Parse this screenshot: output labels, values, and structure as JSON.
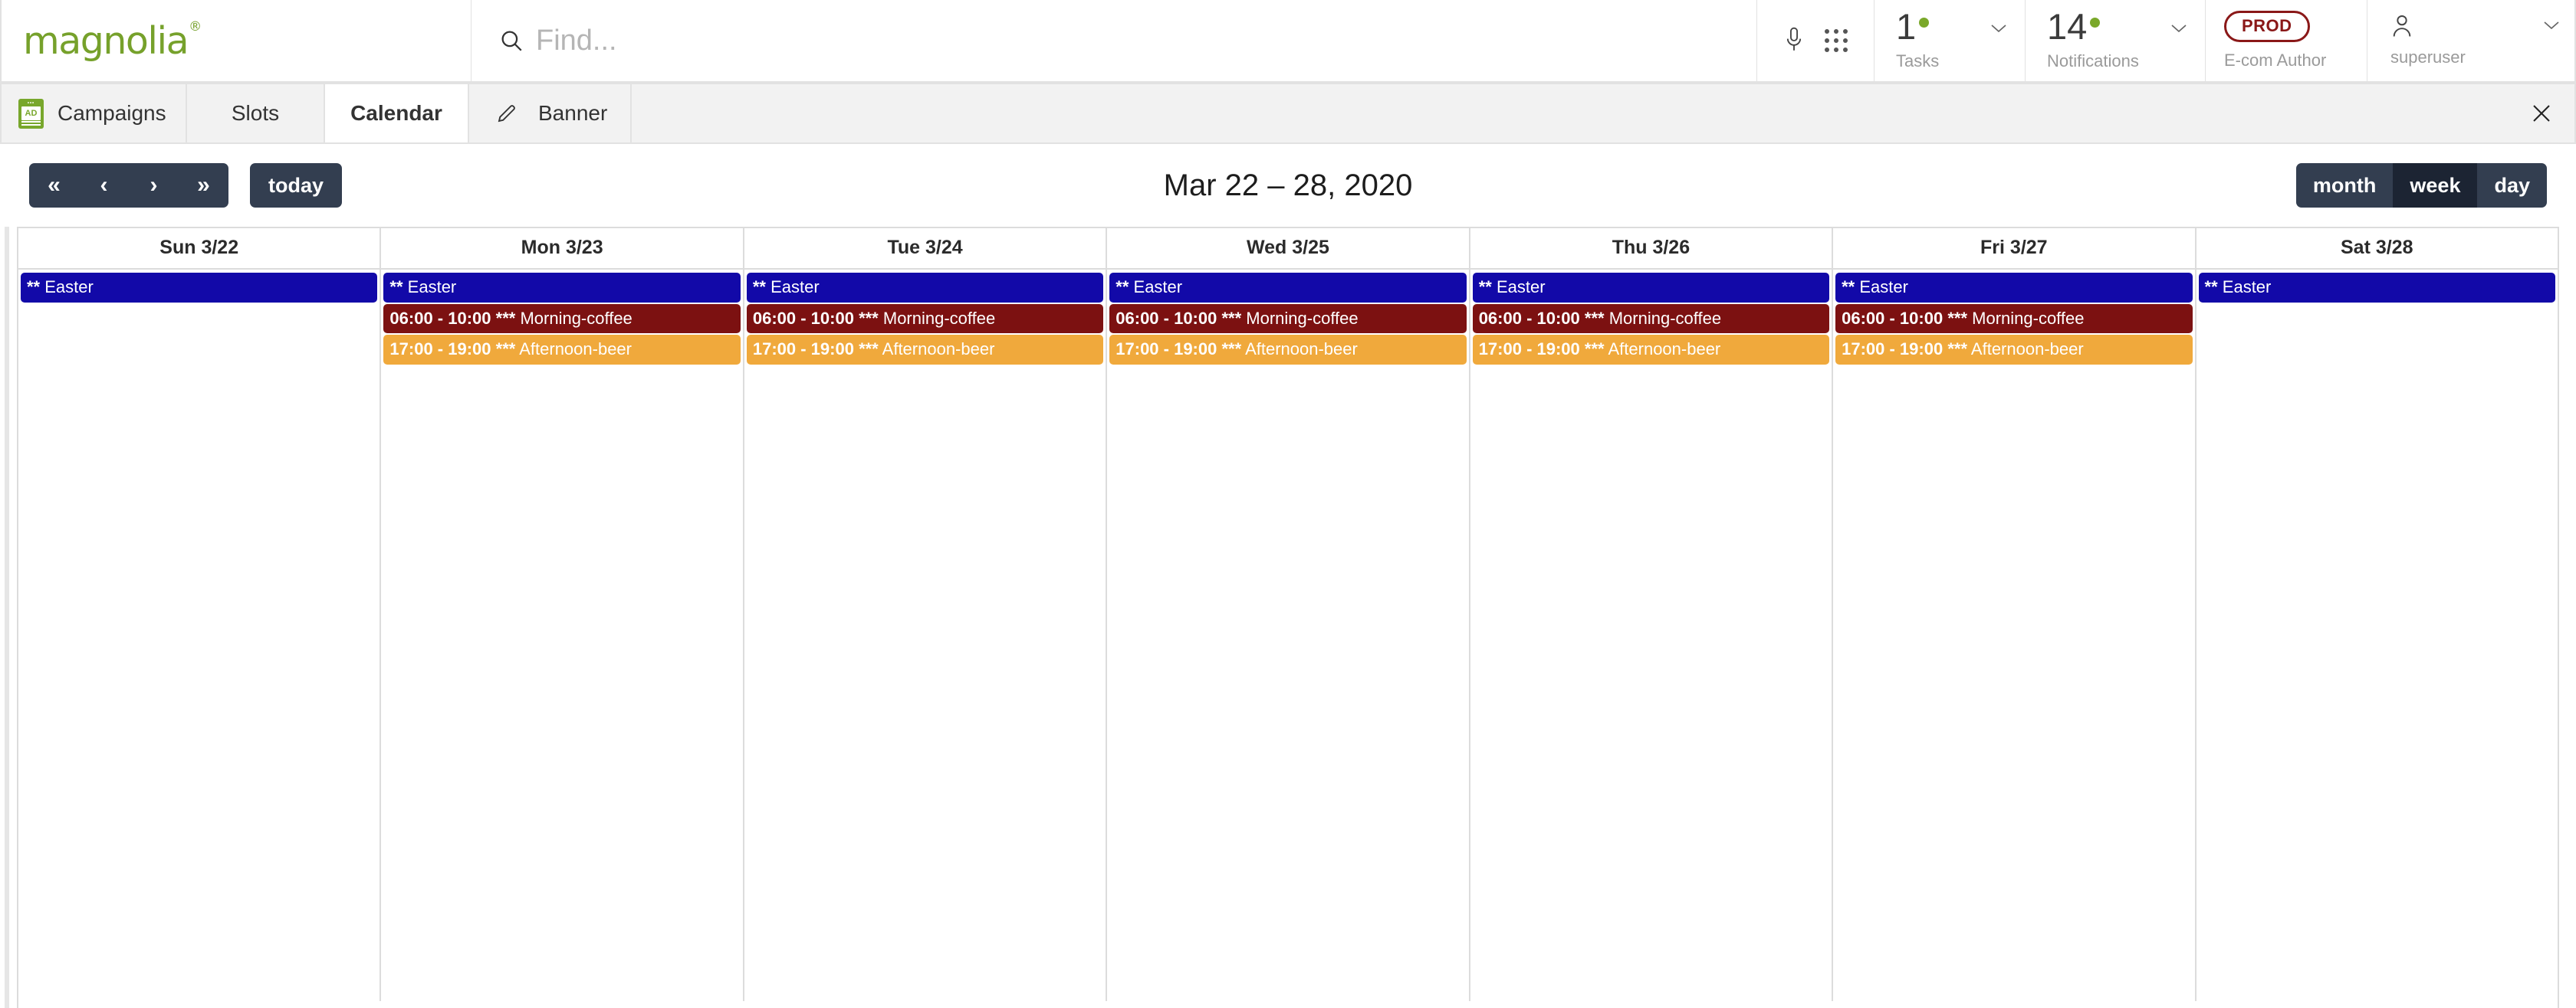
{
  "header": {
    "logo_text": "magnolia",
    "logo_registered": "®",
    "search": {
      "placeholder": "Find...",
      "value": "",
      "icon": "search-icon"
    },
    "mic_icon": "microphone-icon",
    "apps_icon": "apps-grid-icon",
    "tasks": {
      "count": "1",
      "label": "Tasks",
      "has_badge": true,
      "chevron": "chevron-down-icon"
    },
    "notifications": {
      "count": "14",
      "label": "Notifications",
      "has_badge": true,
      "chevron": "chevron-down-icon"
    },
    "environment": {
      "badge": "PROD",
      "label": "E-com Author",
      "color": "#8a1818"
    },
    "user": {
      "name": "superuser",
      "icon": "user-icon",
      "chevron": "chevron-down-icon"
    }
  },
  "tabs": {
    "items": [
      {
        "label": "Campaigns",
        "icon": "ad-app-icon",
        "active": false,
        "closable": false
      },
      {
        "label": "Slots",
        "icon": null,
        "active": false,
        "closable": false
      },
      {
        "label": "Calendar",
        "icon": null,
        "active": true,
        "closable": false
      },
      {
        "label": "Banner",
        "icon": "pencil-icon",
        "active": false,
        "closable": true
      }
    ],
    "close_all_icon": "close-icon"
  },
  "toolbar": {
    "nav": [
      {
        "label": "«",
        "name": "prev-year-button"
      },
      {
        "label": "‹",
        "name": "prev-week-button"
      },
      {
        "label": "›",
        "name": "next-week-button"
      },
      {
        "label": "»",
        "name": "next-year-button"
      }
    ],
    "today_label": "today",
    "title": "Mar 22 – 28, 2020",
    "views": [
      {
        "label": "month",
        "active": false
      },
      {
        "label": "week",
        "active": true
      },
      {
        "label": "day",
        "active": false
      }
    ],
    "button_color": "#333e50",
    "button_active_color": "#1c2433"
  },
  "calendar": {
    "day_headers": [
      "Sun 3/22",
      "Mon 3/23",
      "Tue 3/24",
      "Wed 3/25",
      "Thu 3/26",
      "Fri 3/27",
      "Sat 3/28"
    ],
    "event_colors": {
      "easter": "#1209a8",
      "morning_coffee": "#7c1111",
      "afternoon_beer": "#f0a93c"
    },
    "days": [
      {
        "date": "Sun 3/22",
        "events": [
          {
            "type": "easter",
            "time": "",
            "stars": "**",
            "title": "Easter"
          }
        ]
      },
      {
        "date": "Mon 3/23",
        "events": [
          {
            "type": "easter",
            "time": "",
            "stars": "**",
            "title": "Easter"
          },
          {
            "type": "morning_coffee",
            "time": "06:00 - 10:00",
            "stars": "***",
            "title": "Morning-coffee"
          },
          {
            "type": "afternoon_beer",
            "time": "17:00 - 19:00",
            "stars": "***",
            "title": "Afternoon-beer"
          }
        ]
      },
      {
        "date": "Tue 3/24",
        "events": [
          {
            "type": "easter",
            "time": "",
            "stars": "**",
            "title": "Easter"
          },
          {
            "type": "morning_coffee",
            "time": "06:00 - 10:00",
            "stars": "***",
            "title": "Morning-coffee"
          },
          {
            "type": "afternoon_beer",
            "time": "17:00 - 19:00",
            "stars": "***",
            "title": "Afternoon-beer"
          }
        ]
      },
      {
        "date": "Wed 3/25",
        "events": [
          {
            "type": "easter",
            "time": "",
            "stars": "**",
            "title": "Easter"
          },
          {
            "type": "morning_coffee",
            "time": "06:00 - 10:00",
            "stars": "***",
            "title": "Morning-coffee"
          },
          {
            "type": "afternoon_beer",
            "time": "17:00 - 19:00",
            "stars": "***",
            "title": "Afternoon-beer"
          }
        ]
      },
      {
        "date": "Thu 3/26",
        "events": [
          {
            "type": "easter",
            "time": "",
            "stars": "**",
            "title": "Easter"
          },
          {
            "type": "morning_coffee",
            "time": "06:00 - 10:00",
            "stars": "***",
            "title": "Morning-coffee"
          },
          {
            "type": "afternoon_beer",
            "time": "17:00 - 19:00",
            "stars": "***",
            "title": "Afternoon-beer"
          }
        ]
      },
      {
        "date": "Fri 3/27",
        "events": [
          {
            "type": "easter",
            "time": "",
            "stars": "**",
            "title": "Easter"
          },
          {
            "type": "morning_coffee",
            "time": "06:00 - 10:00",
            "stars": "***",
            "title": "Morning-coffee"
          },
          {
            "type": "afternoon_beer",
            "time": "17:00 - 19:00",
            "stars": "***",
            "title": "Afternoon-beer"
          }
        ]
      },
      {
        "date": "Sat 3/28",
        "events": [
          {
            "type": "easter",
            "time": "",
            "stars": "**",
            "title": "Easter"
          }
        ]
      }
    ]
  }
}
